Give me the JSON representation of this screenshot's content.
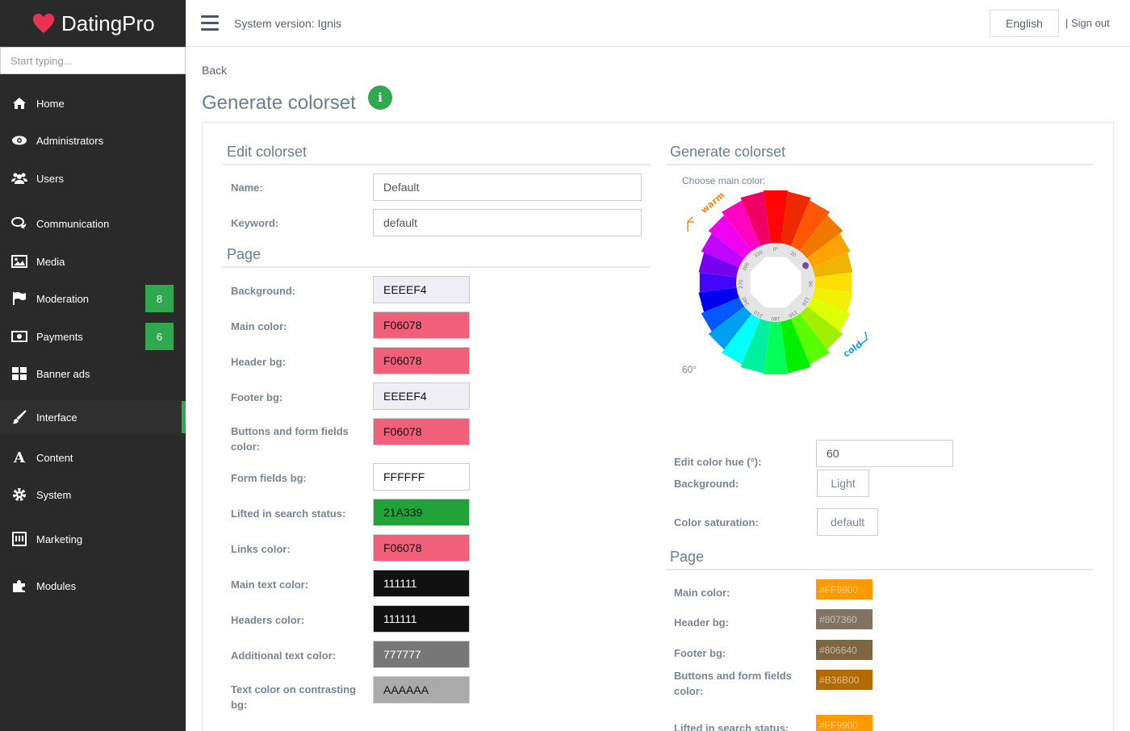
{
  "app": {
    "name": "DatingPro"
  },
  "sidebar": {
    "search_placeholder": "Start typing...",
    "items": [
      {
        "label": "Home",
        "icon": "home-icon"
      },
      {
        "label": "Administrators",
        "icon": "eye-icon"
      },
      {
        "label": "Users",
        "icon": "users-icon"
      },
      {
        "label": "Communication",
        "icon": "comments-icon"
      },
      {
        "label": "Media",
        "icon": "image-icon"
      },
      {
        "label": "Moderation",
        "icon": "flag-icon",
        "badge": "8"
      },
      {
        "label": "Payments",
        "icon": "money-icon",
        "badge": "6"
      },
      {
        "label": "Banner ads",
        "icon": "grid-icon"
      },
      {
        "label": "Interface",
        "icon": "brush-icon",
        "active": true
      },
      {
        "label": "Content",
        "icon": "font-icon"
      },
      {
        "label": "System",
        "icon": "gear-icon"
      },
      {
        "label": "Marketing",
        "icon": "marketing-icon"
      },
      {
        "label": "Modules",
        "icon": "puzzle-icon"
      }
    ]
  },
  "header": {
    "system_version": "System version: Ignis",
    "language": "English",
    "sign_out": "| Sign out"
  },
  "page": {
    "back": "Back",
    "title": "Generate colorset"
  },
  "edit": {
    "title": "Edit colorset",
    "name_label": "Name:",
    "name_value": "Default",
    "keyword_label": "Keyword:",
    "keyword_value": "default",
    "page_title": "Page",
    "colors": [
      {
        "label": "Background:",
        "value": "EEEEF4",
        "bg": "#EEEEF4",
        "fg": "#111111"
      },
      {
        "label": "Main color:",
        "value": "F06078",
        "bg": "#F06078",
        "fg": "#111111"
      },
      {
        "label": "Header bg:",
        "value": "F06078",
        "bg": "#F06078",
        "fg": "#111111"
      },
      {
        "label": "Footer bg:",
        "value": "EEEEF4",
        "bg": "#EEEEF4",
        "fg": "#111111"
      },
      {
        "label": "Buttons and form fields color:",
        "value": "F06078",
        "bg": "#F06078",
        "fg": "#111111"
      },
      {
        "label": "Form fields bg:",
        "value": "FFFFFF",
        "bg": "#FFFFFF",
        "fg": "#111111"
      },
      {
        "label": "Lifted in search status:",
        "value": "21A339",
        "bg": "#21A339",
        "fg": "#111111"
      },
      {
        "label": "Links color:",
        "value": "F06078",
        "bg": "#F06078",
        "fg": "#111111"
      },
      {
        "label": "Main text color:",
        "value": "111111",
        "bg": "#111111",
        "fg": "#FFFFFF"
      },
      {
        "label": "Headers color:",
        "value": "111111",
        "bg": "#111111",
        "fg": "#FFFFFF"
      },
      {
        "label": "Additional text color:",
        "value": "777777",
        "bg": "#777777",
        "fg": "#FFFFFF"
      },
      {
        "label": "Text color on contrasting bg:",
        "value": "AAAAAA",
        "bg": "#AAAAAA",
        "fg": "#111111"
      }
    ]
  },
  "generate": {
    "title": "Generate colorset",
    "choose_label": "Choose main color:",
    "warm_label": "warm",
    "cold_label": "cold",
    "hue_readout": "60°",
    "hue_label": "Edit color hue (°):",
    "hue_value": "60",
    "background_label": "Background:",
    "background_value": "Light",
    "saturation_label": "Color saturation:",
    "saturation_value": "default",
    "page_title": "Page",
    "colors": [
      {
        "label": "Main color:",
        "value": "#FF9900",
        "bg": "#FF9900"
      },
      {
        "label": "Header bg:",
        "value": "#807360",
        "bg": "#807360"
      },
      {
        "label": "Footer bg:",
        "value": "#806640",
        "bg": "#806640"
      },
      {
        "label": "Buttons and form fields color:",
        "value": "#B36B00",
        "bg": "#B36B00"
      },
      {
        "label": "Lifted in search status:",
        "value": "#FF9900",
        "bg": "#FF9900"
      }
    ]
  }
}
